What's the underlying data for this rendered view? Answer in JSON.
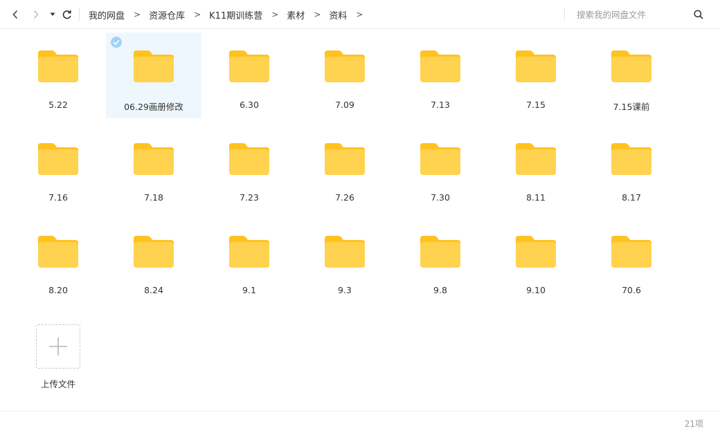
{
  "toolbar": {
    "back_icon": "chevron-left-icon",
    "forward_icon": "chevron-right-icon",
    "history_icon": "caret-down-icon",
    "refresh_icon": "refresh-icon",
    "breadcrumb": [
      "我的网盘",
      "资源仓库",
      "K11期训练营",
      "素材",
      "资料"
    ],
    "breadcrumb_separator": ">",
    "search_placeholder": "搜索我的网盘文件",
    "search_icon": "search-icon"
  },
  "folders": [
    {
      "name": "5.22",
      "selected": false
    },
    {
      "name": "06.29画册修改",
      "selected": true
    },
    {
      "name": "6.30",
      "selected": false
    },
    {
      "name": "7.09",
      "selected": false
    },
    {
      "name": "7.13",
      "selected": false
    },
    {
      "name": "7.15",
      "selected": false
    },
    {
      "name": "7.15课前",
      "selected": false
    },
    {
      "name": "7.16",
      "selected": false
    },
    {
      "name": "7.18",
      "selected": false
    },
    {
      "name": "7.23",
      "selected": false
    },
    {
      "name": "7.26",
      "selected": false
    },
    {
      "name": "7.30",
      "selected": false
    },
    {
      "name": "8.11",
      "selected": false
    },
    {
      "name": "8.17",
      "selected": false
    },
    {
      "name": "8.20",
      "selected": false
    },
    {
      "name": "8.24",
      "selected": false
    },
    {
      "name": "9.1",
      "selected": false
    },
    {
      "name": "9.3",
      "selected": false
    },
    {
      "name": "9.8",
      "selected": false
    },
    {
      "name": "9.10",
      "selected": false
    },
    {
      "name": "70.6",
      "selected": false
    }
  ],
  "upload": {
    "label": "上传文件",
    "icon": "plus-icon"
  },
  "footer": {
    "count": "21项"
  },
  "colors": {
    "folder": "#ffd24f",
    "folder_tab": "#ffc21f",
    "selected_bg": "#eef7fd",
    "check": "#9fd3f4"
  }
}
